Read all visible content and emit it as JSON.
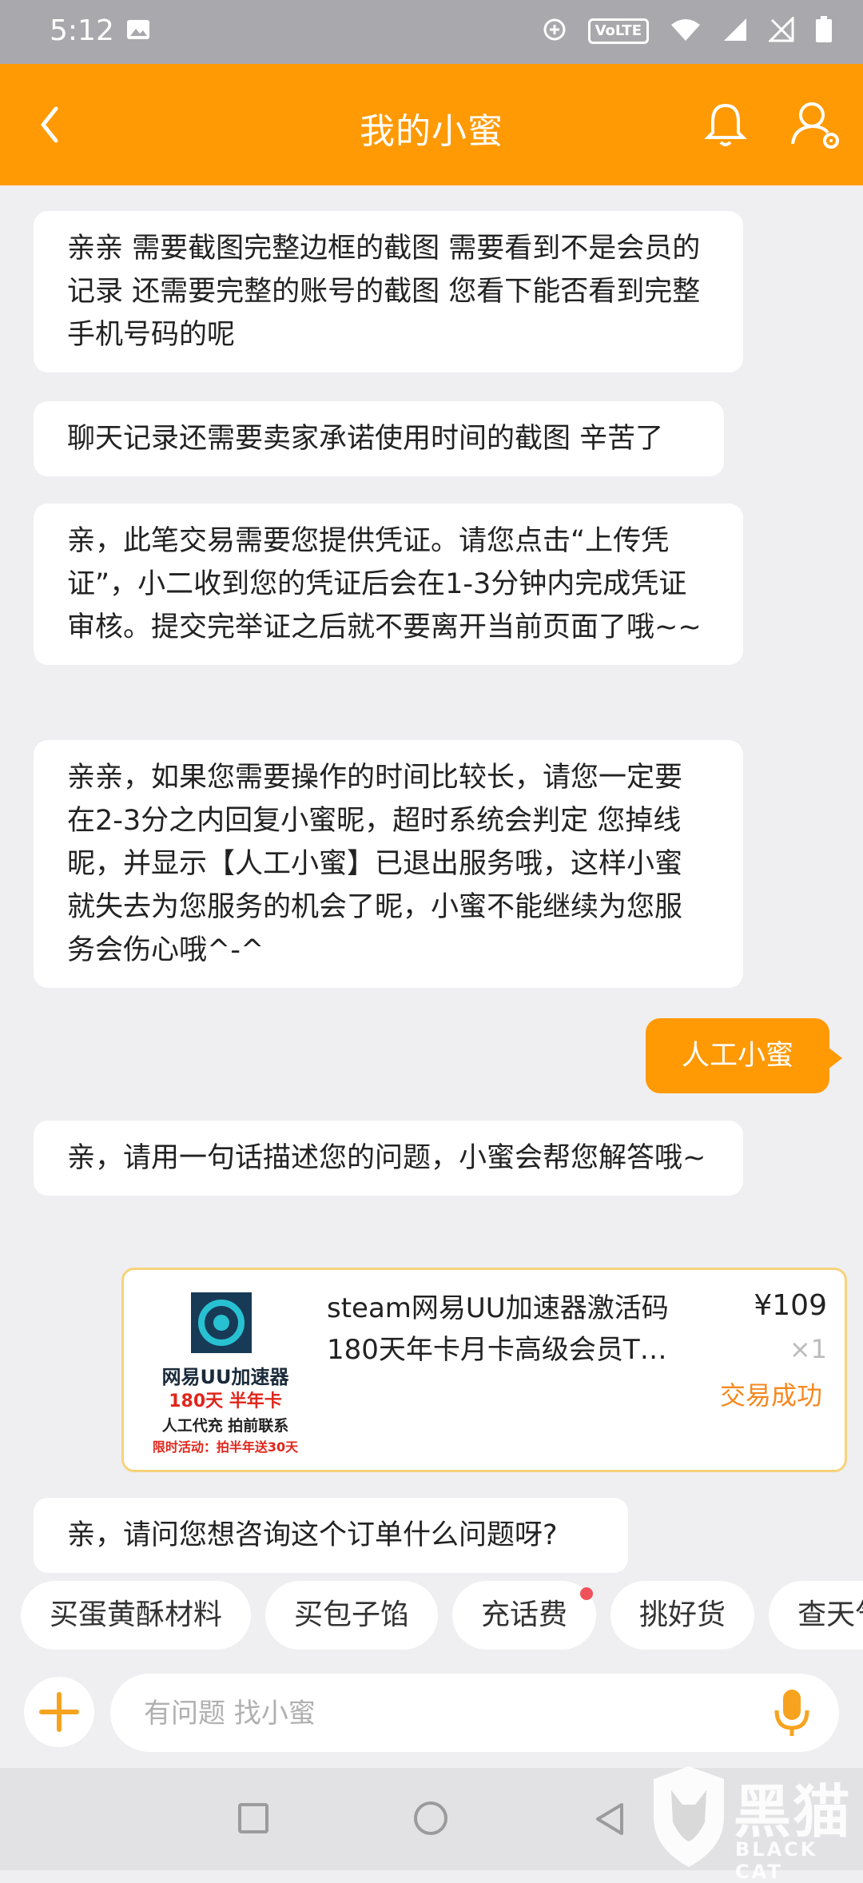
{
  "status_bar": {
    "time": "5:12",
    "volte": "VoLTE"
  },
  "header": {
    "title": "我的小蜜"
  },
  "messages": [
    {
      "from": "agent",
      "text": "亲亲 需要截图完整边框的截图 需要看到不是会员的记录 还需要完整的账号的截图 您看下能否看到完整手机号码的呢"
    },
    {
      "from": "agent",
      "text": "聊天记录还需要卖家承诺使用时间的截图 辛苦了"
    },
    {
      "from": "agent",
      "text": "亲，此笔交易需要您提供凭证。请您点击“上传凭证”，小二收到您的凭证后会在1-3分钟内完成凭证审核。提交完举证之后就不要离开当前页面了哦~~"
    },
    {
      "from": "agent",
      "text": "亲亲，如果您需要操作的时间比较长，请您一定要在2-3分之内回复小蜜昵，超时系统会判定 您掉线昵，并显示【人工小蜜】已退出服务哦，这样小蜜就失去为您服务的机会了昵，小蜜不能继续为您服务会伤心哦^-^"
    },
    {
      "from": "user",
      "text": "人工小蜜"
    },
    {
      "from": "agent",
      "text": "亲，请用一句话描述您的问题，小蜜会帮您解答哦~"
    },
    {
      "from": "agent",
      "text": "亲，请问您想咨询这个订单什么问题呀?"
    }
  ],
  "order": {
    "title": "steam网易UU加速器激活码180天年卡月卡高级会员T…",
    "price": "¥109",
    "quantity": "×1",
    "status": "交易成功",
    "thumb": {
      "brand": "网易UU加速器",
      "line1": "180天 半年卡",
      "line2": "人工代充 拍前联系",
      "line3": "限时活动：拍半年送30天"
    }
  },
  "quick_chips": [
    "买蛋黄酥材料",
    "买包子馅",
    "充话费",
    "挑好货",
    "查天气"
  ],
  "input": {
    "placeholder": "有问题 找小蜜"
  },
  "watermark": {
    "brand": "黑猫",
    "sub": "BLACK CAT"
  },
  "colors": {
    "accent": "#ff9a05",
    "status_success": "#f5891f",
    "chip_dot": "#f0525c"
  }
}
